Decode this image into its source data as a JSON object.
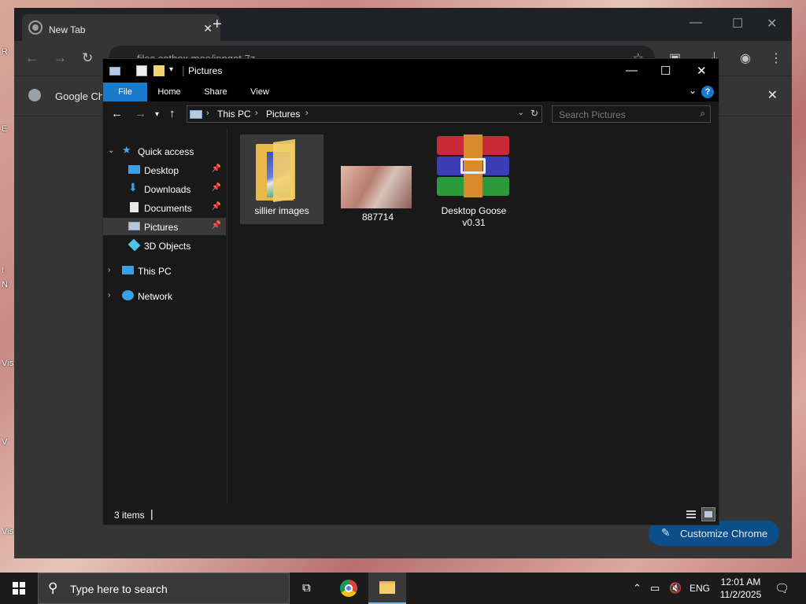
{
  "desktop": {
    "icon_fragments": [
      "R",
      "E",
      "I",
      "N",
      "Vis",
      "V",
      "Vis"
    ]
  },
  "chrome": {
    "tab_title": "New Tab",
    "url": "files.catbox.moe/ippqot.7z",
    "info_text": "Google Ch",
    "customize_label": "Customize Chrome"
  },
  "explorer": {
    "title": "Pictures",
    "ribbon": {
      "file": "File",
      "home": "Home",
      "share": "Share",
      "view": "View"
    },
    "breadcrumb": [
      "This PC",
      "Pictures"
    ],
    "search_placeholder": "Search Pictures",
    "nav": {
      "quick_access": "Quick access",
      "items": [
        "Desktop",
        "Downloads",
        "Documents",
        "Pictures",
        "3D Objects"
      ],
      "this_pc": "This PC",
      "network": "Network"
    },
    "files": [
      {
        "name": "sillier images",
        "type": "folder"
      },
      {
        "name": "887714",
        "type": "image"
      },
      {
        "name": "Desktop Goose v0.31",
        "type": "archive"
      }
    ],
    "status": "3 items"
  },
  "taskbar": {
    "search_text": "Type here to search",
    "lang": "ENG",
    "time": "12:01 AM",
    "date": "11/2/2025"
  },
  "colors": {
    "accent": "#1979ca",
    "explorer_bg": "#191919",
    "chrome_bg": "#353535"
  }
}
